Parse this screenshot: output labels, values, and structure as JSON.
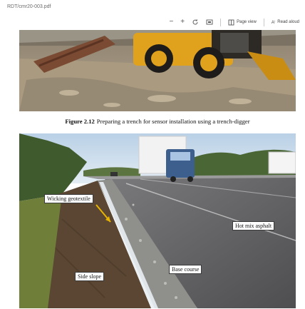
{
  "document": {
    "file_name": "RDT/cmr20-003.pdf"
  },
  "toolbar": {
    "zoom_out": "−",
    "zoom_in": "+",
    "page_view_label": "Page view",
    "read_aloud_prefix": "A⁾",
    "read_aloud_label": "Read aloud"
  },
  "figure": {
    "number": "Figure 2.12",
    "caption": "Preparing a trench for sensor installation using a trench-digger"
  },
  "photo_labels": {
    "wicking_geotextile": "Wicking geotextile",
    "hot_mix_asphalt": "Hot mix asphalt",
    "base_course": "Base course",
    "side_slope": "Side slope"
  },
  "colors": {
    "machine_yellow": "#e0a21c",
    "sky": "#cfe0ee",
    "asphalt": "#5d5d5f",
    "grass": "#6f7f3a",
    "arrow": "#e8b400"
  }
}
